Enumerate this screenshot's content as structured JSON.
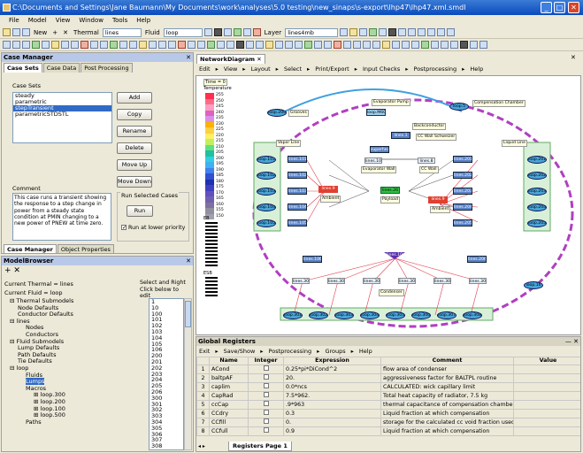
{
  "window": {
    "title": "C:\\Documents and Settings\\Jane Baumann\\My Documents\\work\\analyses\\5.0 testing\\new_sinaps\\s-export\\lhp47\\lhp47.xml.smdl",
    "min": "_",
    "max": "□",
    "close": "✕"
  },
  "menu": [
    "File",
    "Model",
    "View",
    "Window",
    "Tools",
    "Help"
  ],
  "toolbar": {
    "new_label": "New",
    "thermal_label": "Thermal",
    "thermal_value": "lines",
    "fluid_label": "Fluid",
    "fluid_value": "loop",
    "layer_label": "Layer",
    "layer_value": "lines4mb"
  },
  "case_manager": {
    "title": "Case Manager",
    "tabs": [
      "Case Sets",
      "Case Data",
      "Post Processing"
    ],
    "case_sets_label": "Case Sets",
    "cases": [
      "steady",
      "parametric",
      "stepTransient",
      "parametricSTDSTL"
    ],
    "selected_case": "stepTransient",
    "buttons": [
      "Add",
      "Copy",
      "Rename",
      "Delete",
      "Move Up",
      "Move Down"
    ],
    "comment_label": "Comment",
    "comment": "This case runs a transient showing the response to a step change in power from a steady state condition at PMIN changing to a new power of PNEW at time zero.",
    "run_selected_label": "Run Selected Cases",
    "run_label": "Run",
    "run_lower_label": "Run at lower priority",
    "bottom_tabs": [
      "Case Manager",
      "Object Properties"
    ]
  },
  "model_browser": {
    "title": "ModelBrowser",
    "current_thermal": "Current Thermal = lines",
    "current_fluid": "Current Fluid = loop",
    "select_hint": "Select and Right Click below to edit",
    "tree": [
      {
        "t": "Thermal Submodels",
        "d": 0
      },
      {
        "t": "Node Defaults",
        "d": 1
      },
      {
        "t": "Conductor Defaults",
        "d": 1
      },
      {
        "t": "lines",
        "d": 0
      },
      {
        "t": "Nodes",
        "d": 2
      },
      {
        "t": "Conductors",
        "d": 2
      },
      {
        "t": "Fluid Submodels",
        "d": 0
      },
      {
        "t": "Lump Defaults",
        "d": 1
      },
      {
        "t": "Path Defaults",
        "d": 1
      },
      {
        "t": "Tie Defaults",
        "d": 1
      },
      {
        "t": "loop",
        "d": 0
      },
      {
        "t": "Fluids",
        "d": 2
      },
      {
        "t": "Lumps",
        "d": 2,
        "sel": true
      },
      {
        "t": "Macros",
        "d": 2
      },
      {
        "t": "loop.300",
        "d": 3
      },
      {
        "t": "loop.200",
        "d": 3
      },
      {
        "t": "loop.100",
        "d": 3
      },
      {
        "t": "loop.500",
        "d": 3
      },
      {
        "t": "Paths",
        "d": 2
      }
    ],
    "ids": [
      "1",
      "10",
      "100",
      "101",
      "102",
      "103",
      "104",
      "105",
      "106",
      "200",
      "201",
      "202",
      "203",
      "204",
      "205",
      "206",
      "300",
      "301",
      "302",
      "303",
      "304",
      "305",
      "306",
      "307",
      "308"
    ]
  },
  "diagram": {
    "title": "NetworkDiagram",
    "menu": [
      "Edit",
      "View",
      "Layout",
      "Select",
      "Print/Export",
      "Input Checks",
      "Postprocessing",
      "Help"
    ],
    "time_label": "Time = 0",
    "temp_label": "Temperature",
    "scale": [
      "255",
      "250",
      "245",
      "240",
      "235",
      "230",
      "225",
      "220",
      "215",
      "210",
      "205",
      "200",
      "195",
      "190",
      "185",
      "180",
      "175",
      "170",
      "165",
      "160",
      "155",
      "150"
    ],
    "scale_colors": [
      "#ff2f4f",
      "#ff6a8a",
      "#ff9fc0",
      "#e060c0",
      "#d890e8",
      "#ffb000",
      "#ffd040",
      "#fff060",
      "#c0f060",
      "#60e080",
      "#20c0a0",
      "#30d0e0",
      "#40b0f0",
      "#4080f0",
      "#3050d0",
      "#2030b0",
      "#4040c0",
      "#6050c0",
      "#7060b0",
      "#8070a0",
      "#9090a0",
      "#a0a0b0"
    ],
    "legend2_label": "EB",
    "legend3_label": "ESB"
  },
  "registers": {
    "title": "Global Registers",
    "menu": [
      "Exit",
      "Save/Show",
      "Postprocessing",
      "Groups",
      "Help"
    ],
    "columns": [
      "",
      "Name",
      "Integer",
      "Expression",
      "Comment",
      "Value"
    ],
    "rows": [
      {
        "n": "1",
        "name": "ACond",
        "expr": "0.25*pi*DiCond^2",
        "comment": "flow area of condenser"
      },
      {
        "n": "2",
        "name": "baltpAF",
        "expr": "20.",
        "comment": "aggressiveness factor for BALTPL routine"
      },
      {
        "n": "3",
        "name": "caplim",
        "expr": "0.0*ncs",
        "comment": "CALCULATED: wick capillary limit"
      },
      {
        "n": "4",
        "name": "CapRad",
        "expr": "7.5*962.",
        "comment": "Total heat capacity of radiator, 7.5 kg"
      },
      {
        "n": "5",
        "name": "ccCap",
        "expr": ".9*963",
        "comment": "thermal capacitance of compensation chamber ("
      },
      {
        "n": "6",
        "name": "CCdry",
        "expr": "0.3",
        "comment": "Liquid fraction at which compensation"
      },
      {
        "n": "7",
        "name": "CCfill",
        "expr": "0.",
        "comment": "storage for the calculated cc void fraction used f"
      },
      {
        "n": "8",
        "name": "CCfull",
        "expr": "0.9",
        "comment": "Liquid fraction at which compensation"
      }
    ],
    "sheet_tab": "Registers Page 1"
  }
}
